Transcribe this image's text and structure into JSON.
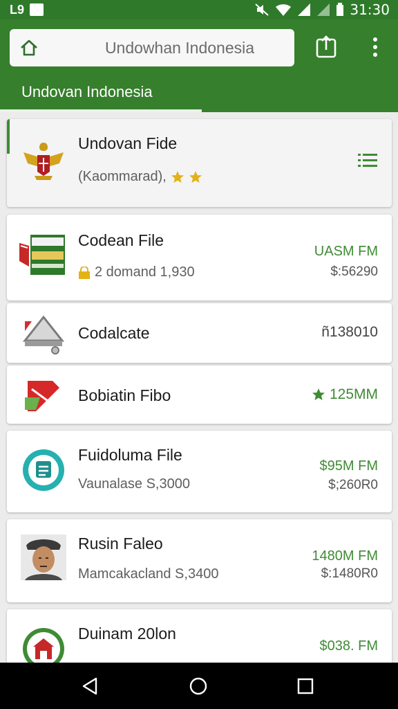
{
  "status_bar": {
    "left_icons": [
      "L9",
      "notification-icon"
    ],
    "time": "31:30",
    "right_icons": [
      "mute-icon",
      "wifi-icon",
      "signal-icon",
      "signal-icon",
      "battery-icon"
    ]
  },
  "app_bar": {
    "search_text": "Undowhan Indonesia",
    "icons": [
      "home-icon",
      "share-icon",
      "more-vert-icon"
    ]
  },
  "tab": {
    "label": "Undovan Indonesia"
  },
  "list": [
    {
      "title": "Undovan Fide",
      "subtitle": "(Kaommarad),",
      "icon": "garuda-emblem-icon",
      "right_icon": "list-icon"
    },
    {
      "title": "Codean File",
      "subtitle": "2 domand 1,930",
      "right_top": "UASM FM",
      "right_bottom": "$:56290",
      "icon": "banner-icon"
    },
    {
      "title": "Codalcate",
      "right_mid": "ñ138010",
      "icon": "device-icon"
    },
    {
      "title": "Bobiatin Fibo",
      "right_mid": "125MM",
      "icon": "flag-icon"
    },
    {
      "title": "Fuidoluma File",
      "subtitle": "Vaunalase S,3000",
      "right_top": "$95M FM",
      "right_bottom": "$;260R0",
      "icon": "chat-icon"
    },
    {
      "title": "Rusin Faleo",
      "subtitle": "Mamcakacland S,3400",
      "right_top": "1480M FM",
      "right_bottom": "$:1480R0",
      "icon": "avatar-icon"
    },
    {
      "title": "Duinam 20lon",
      "right_top": "$038. FM",
      "icon": "house-icon"
    }
  ],
  "colors": {
    "primary": "#367f2c",
    "accent_green": "#3f8b35",
    "gold": "#e3b214"
  },
  "nav": {
    "icons": [
      "back-icon",
      "home-circle-icon",
      "recents-icon"
    ]
  }
}
